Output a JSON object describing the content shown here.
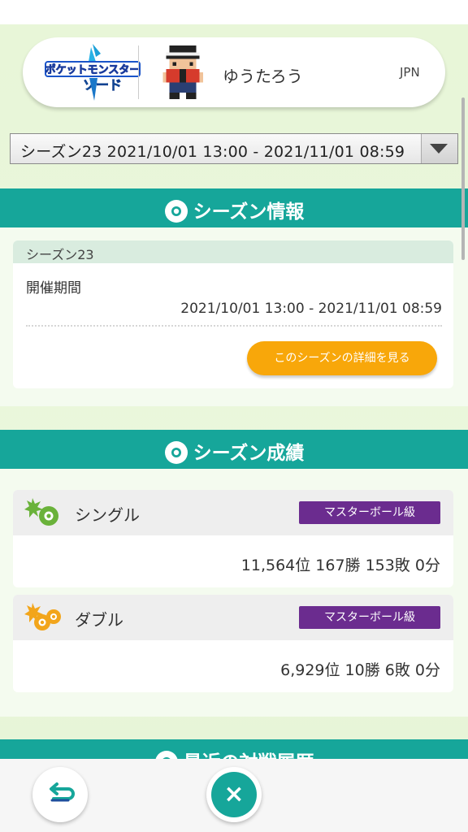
{
  "profile": {
    "game_logo_text": "ポケットモンスター ソード",
    "player_name": "ゆうたろう",
    "region": "JPN"
  },
  "season_select": {
    "selected": "シーズン23 2021/10/01 13:00 - 2021/11/01 08:59"
  },
  "season_info": {
    "section_title": "シーズン情報",
    "season_name": "シーズン23",
    "period_label": "開催期間",
    "period_value": "2021/10/01 13:00 - 2021/11/01 08:59",
    "detail_button": "このシーズンの詳細を見る"
  },
  "season_results": {
    "section_title": "シーズン成績",
    "single": {
      "label": "シングル",
      "rank_class": "マスターボール級",
      "record": "11,564位 167勝 153敗 0分"
    },
    "double": {
      "label": "ダブル",
      "rank_class": "マスターボール級",
      "record": "6,929位 10勝 6敗 0分"
    }
  },
  "recent_battles": {
    "section_title": "最近の対戦履歴"
  },
  "bottom_bar": {
    "close_glyph": "×"
  },
  "colors": {
    "teal": "#16a69a",
    "orange_button": "#f8a70a",
    "rank_badge": "#6b2c8f",
    "page_background": "#e8f6d8"
  }
}
